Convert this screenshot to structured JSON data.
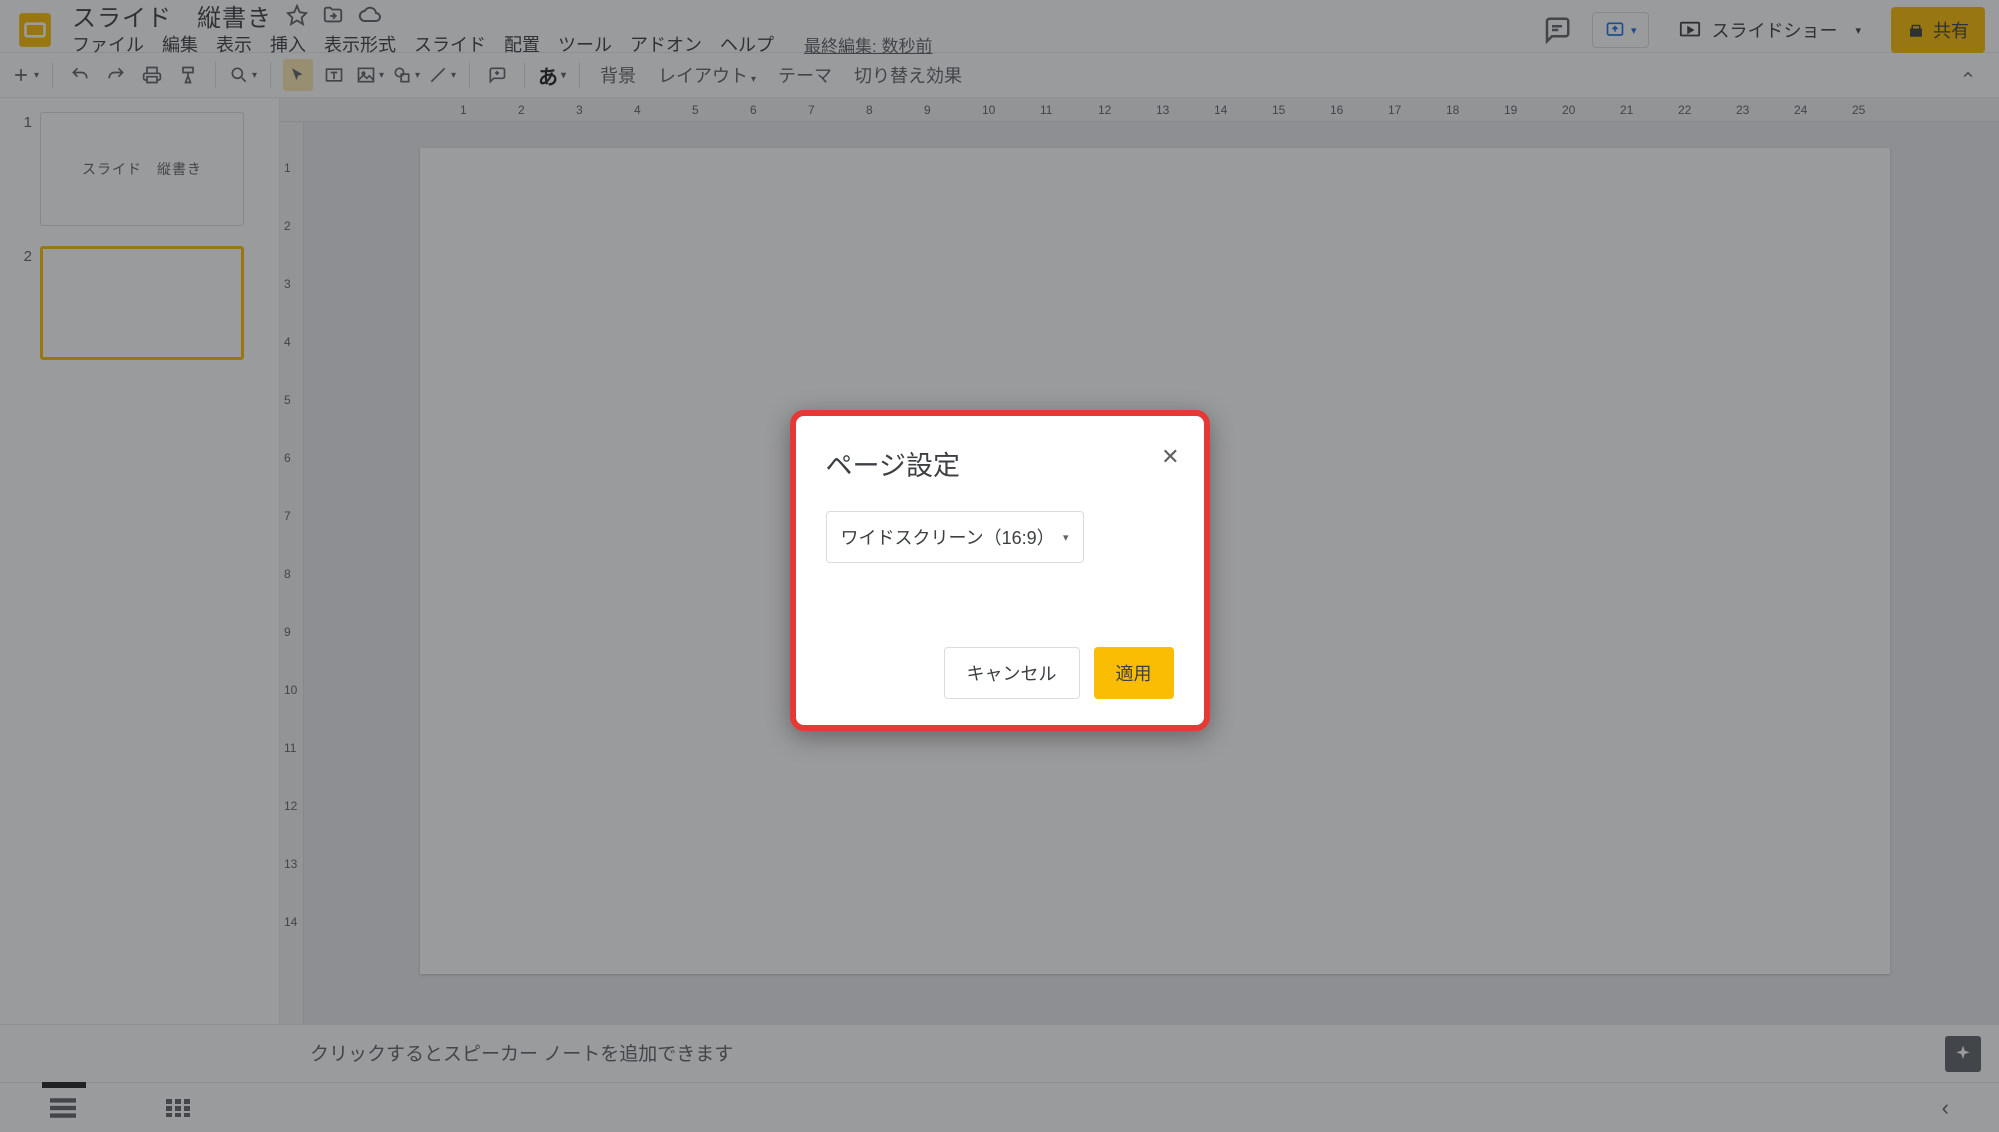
{
  "header": {
    "doc_title": "スライド　縦書き",
    "menus": [
      "ファイル",
      "編集",
      "表示",
      "挿入",
      "表示形式",
      "スライド",
      "配置",
      "ツール",
      "アドオン",
      "ヘルプ"
    ],
    "last_edit": "最終編集: 数秒前",
    "slideshow_label": "スライドショー",
    "share_label": "共有"
  },
  "toolbar": {
    "background": "背景",
    "layout": "レイアウト",
    "theme": "テーマ",
    "transition": "切り替え効果",
    "ime": "あ"
  },
  "thumbnails": {
    "items": [
      {
        "num": "1",
        "label": "スライド　縦書き"
      },
      {
        "num": "2",
        "label": ""
      }
    ]
  },
  "ruler": {
    "h": [
      "1",
      "2",
      "3",
      "4",
      "5",
      "6",
      "7",
      "8",
      "9",
      "10",
      "11",
      "12",
      "13",
      "14",
      "15",
      "16",
      "17",
      "18",
      "19",
      "20",
      "21",
      "22",
      "23",
      "24",
      "25"
    ],
    "v": [
      "1",
      "2",
      "3",
      "4",
      "5",
      "6",
      "7",
      "8",
      "9",
      "10",
      "11",
      "12",
      "13",
      "14"
    ]
  },
  "notes": {
    "placeholder": "クリックするとスピーカー ノートを追加できます"
  },
  "dialog": {
    "title": "ページ設定",
    "select_value": "ワイドスクリーン（16:9）",
    "cancel": "キャンセル",
    "apply": "適用"
  }
}
